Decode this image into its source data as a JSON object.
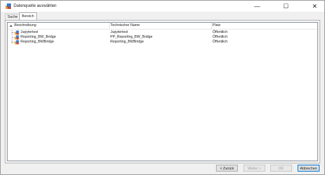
{
  "window": {
    "title": "Datenquelle auswählen",
    "minimize_symbol": "—",
    "maximize_symbol": "☐",
    "close_symbol": "✕"
  },
  "tabs": [
    {
      "label": "Suche",
      "active": false
    },
    {
      "label": "Bereich",
      "active": true
    }
  ],
  "table": {
    "columns": [
      "Beschreibung",
      "Technischer Name",
      "Platz"
    ],
    "rows": [
      {
        "description": "Jupytertest",
        "technical_name": "Jupytertest",
        "place": "Öffentlich",
        "icon": "data-source-icon"
      },
      {
        "description": "Reporting_BW_Bridge",
        "technical_name": "PP_Reporting_BW_Bridge",
        "place": "Öffentlich",
        "icon": "data-source-icon"
      },
      {
        "description": "Reporting_BWBridge",
        "technical_name": "Reporting_BWBridge",
        "place": "Öffentlich",
        "icon": "data-source-icon"
      }
    ]
  },
  "footer": {
    "back_label": "< Zurück",
    "next_label": "Weiter >",
    "ok_label": "OK",
    "cancel_label": "Abbrechen"
  },
  "colors": {
    "accent": "#0078d7",
    "window_bg": "#f0f0f0",
    "icon_orange": "#e8a33a",
    "icon_blue": "#3a78c8"
  }
}
